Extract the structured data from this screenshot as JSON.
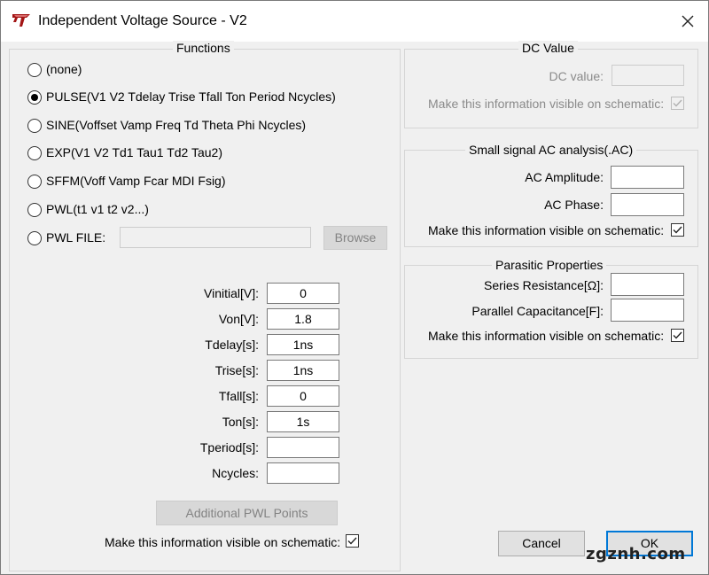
{
  "window": {
    "title": "Independent Voltage Source - V2"
  },
  "functions": {
    "group_title": "Functions",
    "options": [
      {
        "label": "(none)",
        "selected": false
      },
      {
        "label": "PULSE(V1 V2 Tdelay Trise Tfall Ton Period Ncycles)",
        "selected": true
      },
      {
        "label": "SINE(Voffset Vamp Freq Td Theta Phi Ncycles)",
        "selected": false
      },
      {
        "label": "EXP(V1 V2 Td1 Tau1 Td2 Tau2)",
        "selected": false
      },
      {
        "label": "SFFM(Voff Vamp Fcar MDI Fsig)",
        "selected": false
      },
      {
        "label": "PWL(t1 v1 t2 v2...)",
        "selected": false
      },
      {
        "label": "PWL FILE:",
        "selected": false
      }
    ],
    "pwl_file_value": "",
    "browse_label": "Browse",
    "params": [
      {
        "label": "Vinitial[V]:",
        "value": "0"
      },
      {
        "label": "Von[V]:",
        "value": "1.8"
      },
      {
        "label": "Tdelay[s]:",
        "value": "1ns"
      },
      {
        "label": "Trise[s]:",
        "value": "1ns"
      },
      {
        "label": "Tfall[s]:",
        "value": "0"
      },
      {
        "label": "Ton[s]:",
        "value": "1s"
      },
      {
        "label": "Tperiod[s]:",
        "value": ""
      },
      {
        "label": "Ncycles:",
        "value": ""
      }
    ],
    "additional_pwl_label": "Additional PWL Points",
    "visible_label": "Make this information visible on schematic:",
    "visible_checked": true
  },
  "dc": {
    "group_title": "DC Value",
    "value_label": "DC value:",
    "value": "",
    "visible_label": "Make this information visible on schematic:",
    "visible_checked": true
  },
  "ac": {
    "group_title": "Small signal AC analysis(.AC)",
    "amplitude_label": "AC Amplitude:",
    "amplitude_value": "",
    "phase_label": "AC Phase:",
    "phase_value": "",
    "visible_label": "Make this information visible on schematic:",
    "visible_checked": true
  },
  "parasitic": {
    "group_title": "Parasitic Properties",
    "series_label": "Series Resistance[Ω]:",
    "series_value": "",
    "parallel_label": "Parallel Capacitance[F]:",
    "parallel_value": "",
    "visible_label": "Make this information visible on schematic:",
    "visible_checked": true
  },
  "buttons": {
    "cancel": "Cancel",
    "ok": "OK"
  },
  "watermark": "zgznh.com"
}
